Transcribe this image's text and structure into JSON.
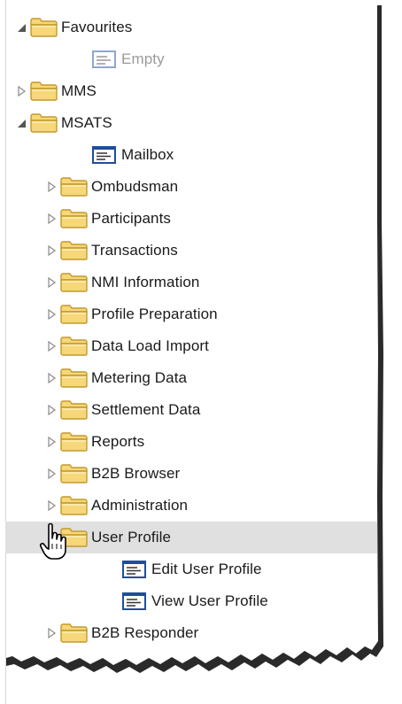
{
  "tree": {
    "items": [
      {
        "label": "Favourites",
        "level": 0,
        "type": "folder",
        "state": "expanded"
      },
      {
        "label": "Empty",
        "level": 1,
        "type": "leaf",
        "state": "leaf",
        "muted": true
      },
      {
        "label": "MMS",
        "level": 0,
        "type": "folder",
        "state": "collapsed"
      },
      {
        "label": "MSATS",
        "level": 0,
        "type": "folder",
        "state": "expanded"
      },
      {
        "label": "Mailbox",
        "level": 1,
        "type": "leaf",
        "state": "leaf"
      },
      {
        "label": "Ombudsman",
        "level": 1,
        "type": "folder",
        "state": "collapsed"
      },
      {
        "label": "Participants",
        "level": 1,
        "type": "folder",
        "state": "collapsed"
      },
      {
        "label": "Transactions",
        "level": 1,
        "type": "folder",
        "state": "collapsed"
      },
      {
        "label": "NMI Information",
        "level": 1,
        "type": "folder",
        "state": "collapsed"
      },
      {
        "label": "Profile Preparation",
        "level": 1,
        "type": "folder",
        "state": "collapsed"
      },
      {
        "label": "Data Load Import",
        "level": 1,
        "type": "folder",
        "state": "collapsed"
      },
      {
        "label": "Metering Data",
        "level": 1,
        "type": "folder",
        "state": "collapsed"
      },
      {
        "label": "Settlement Data",
        "level": 1,
        "type": "folder",
        "state": "collapsed"
      },
      {
        "label": "Reports",
        "level": 1,
        "type": "folder",
        "state": "collapsed"
      },
      {
        "label": "B2B Browser",
        "level": 1,
        "type": "folder",
        "state": "collapsed"
      },
      {
        "label": "Administration",
        "level": 1,
        "type": "folder",
        "state": "collapsed"
      },
      {
        "label": "User Profile",
        "level": 1,
        "type": "folder",
        "state": "expanded",
        "selected": true
      },
      {
        "label": "Edit User Profile",
        "level": 2,
        "type": "leaf",
        "state": "leaf"
      },
      {
        "label": "View User Profile",
        "level": 2,
        "type": "leaf",
        "state": "leaf"
      },
      {
        "label": "B2B Responder",
        "level": 1,
        "type": "folder",
        "state": "collapsed"
      }
    ]
  },
  "icons": {
    "folder": "folder-icon",
    "leaf": "form-page-icon",
    "expanded": "expanded-arrow-icon",
    "collapsed": "collapsed-arrow-icon",
    "cursor": "hand-pointer-icon"
  },
  "colors": {
    "folder_fill": "#f6d77a",
    "folder_edge": "#c49a2c",
    "selected_row": "#e0e0e0",
    "leaf_icon_border": "#1f4e9a",
    "muted_text": "#9a9a9a"
  }
}
